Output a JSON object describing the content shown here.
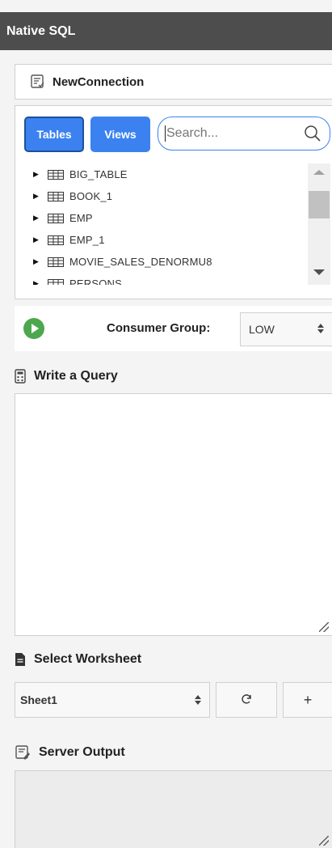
{
  "title": "Native SQL",
  "connection": {
    "label": "NewConnection",
    "icon": "connection-icon"
  },
  "browser": {
    "tables_label": "Tables",
    "views_label": "Views",
    "search_placeholder": "Search...",
    "items": [
      "BIG_TABLE",
      "BOOK_1",
      "EMP",
      "EMP_1",
      "MOVIE_SALES_DENORMU8",
      "PERSONS"
    ]
  },
  "run": {
    "consumer_group_label": "Consumer Group:",
    "consumer_group_value": "LOW"
  },
  "query": {
    "title": "Write a Query",
    "value": ""
  },
  "worksheet": {
    "title": "Select Worksheet",
    "selected": "Sheet1",
    "add_label": "+"
  },
  "output": {
    "title": "Server Output"
  },
  "colors": {
    "title_bg": "#4d4d4d",
    "accent": "#3b82f0",
    "run_green": "#4ca84f"
  }
}
